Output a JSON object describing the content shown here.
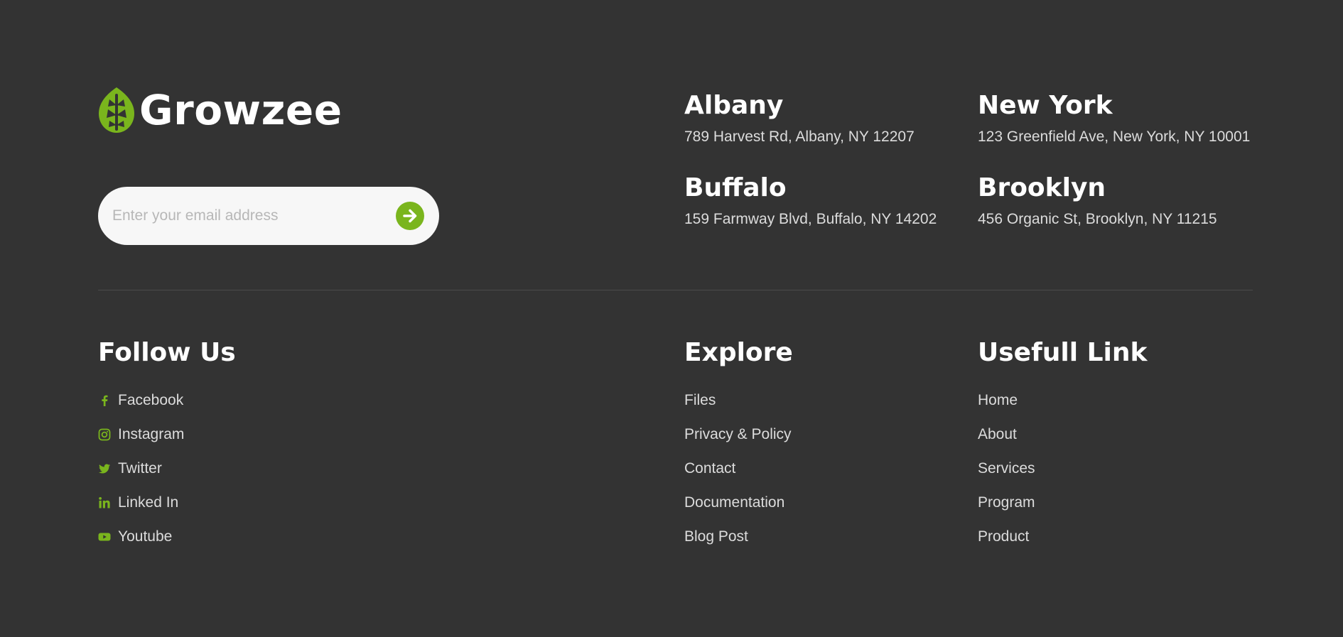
{
  "brand": {
    "name": "Growzee",
    "logo_icon": "leaf-logo-icon",
    "accent_color": "#7ab51d",
    "background_color": "#333333"
  },
  "newsletter": {
    "placeholder": "Enter your email address",
    "value": "",
    "submit_icon": "arrow-right-icon"
  },
  "locations": [
    {
      "name": "Albany",
      "address": "789 Harvest Rd, Albany, NY 12207"
    },
    {
      "name": "New York",
      "address": "123 Greenfield Ave, New York, NY 10001"
    },
    {
      "name": "Buffalo",
      "address": "159 Farmway Blvd, Buffalo, NY 14202"
    },
    {
      "name": "Brooklyn",
      "address": "456 Organic St, Brooklyn, NY 11215"
    }
  ],
  "follow": {
    "title": "Follow Us",
    "items": [
      {
        "label": "Facebook",
        "icon": "facebook-icon"
      },
      {
        "label": "Instagram",
        "icon": "instagram-icon"
      },
      {
        "label": "Twitter",
        "icon": "twitter-icon"
      },
      {
        "label": "Linked In",
        "icon": "linkedin-icon"
      },
      {
        "label": "Youtube",
        "icon": "youtube-icon"
      }
    ]
  },
  "explore": {
    "title": "Explore",
    "items": [
      "Files",
      "Privacy & Policy",
      "Contact",
      "Documentation",
      "Blog Post"
    ]
  },
  "useful": {
    "title": "Usefull Link",
    "items": [
      "Home",
      "About",
      "Services",
      "Program",
      "Product"
    ]
  }
}
